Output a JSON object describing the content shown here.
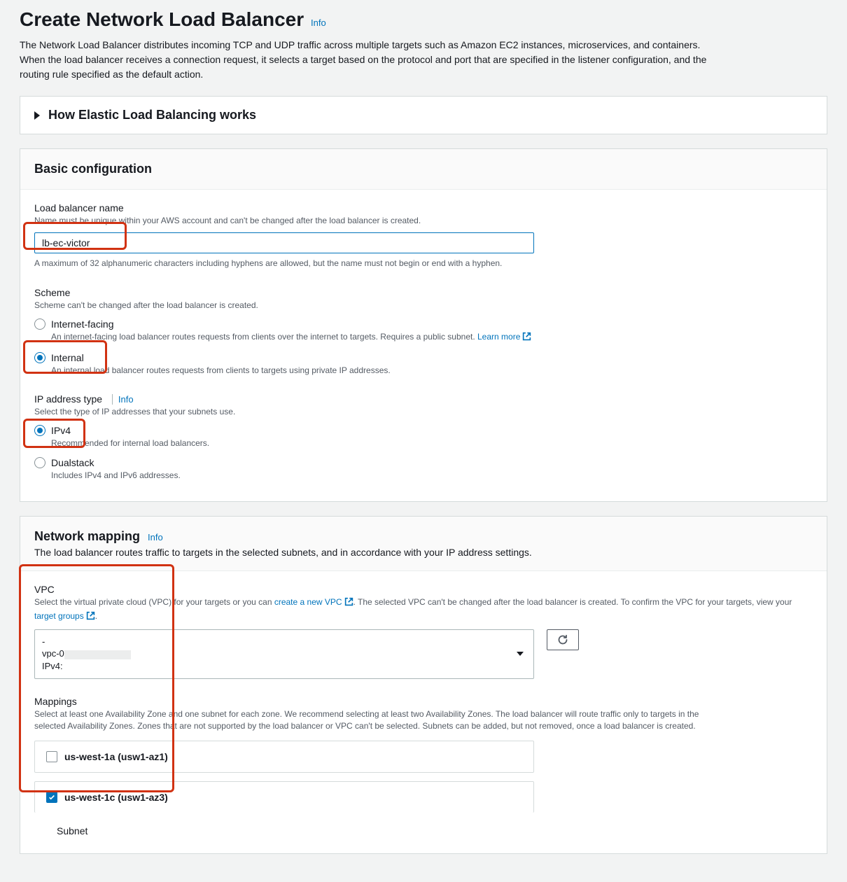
{
  "page": {
    "title": "Create Network Load Balancer",
    "info_label": "Info",
    "description": "The Network Load Balancer distributes incoming TCP and UDP traffic across multiple targets such as Amazon EC2 instances, microservices, and containers. When the load balancer receives a connection request, it selects a target based on the protocol and port that are specified in the listener configuration, and the routing rule specified as the default action."
  },
  "how_works": {
    "title": "How Elastic Load Balancing works"
  },
  "basic": {
    "title": "Basic configuration",
    "name": {
      "label": "Load balancer name",
      "hint_top": "Name must be unique within your AWS account and can't be changed after the load balancer is created.",
      "value": "lb-ec-victor",
      "hint_bottom": "A maximum of 32 alphanumeric characters including hyphens are allowed, but the name must not begin or end with a hyphen."
    },
    "scheme": {
      "label": "Scheme",
      "hint": "Scheme can't be changed after the load balancer is created.",
      "internet_facing": {
        "label": "Internet-facing",
        "desc_pre": "An internet-facing load balancer routes requests from clients over the internet to targets. Requires a public subnet. ",
        "learn_more": "Learn more"
      },
      "internal": {
        "label": "Internal",
        "desc": "An internal load balancer routes requests from clients to targets using private IP addresses."
      }
    },
    "ip_type": {
      "label": "IP address type",
      "info": "Info",
      "hint": "Select the type of IP addresses that your subnets use.",
      "ipv4": {
        "label": "IPv4",
        "desc": "Recommended for internal load balancers."
      },
      "dualstack": {
        "label": "Dualstack",
        "desc": "Includes IPv4 and IPv6 addresses."
      }
    }
  },
  "network": {
    "title": "Network mapping",
    "info": "Info",
    "desc": "The load balancer routes traffic to targets in the selected subnets, and in accordance with your IP address settings.",
    "vpc": {
      "label": "VPC",
      "desc_pre": "Select the virtual private cloud (VPC) for your targets or you can ",
      "create_link": "create a new VPC",
      "desc_mid": ". The selected VPC can't be changed after the load balancer is created. To confirm the VPC for your targets, view your ",
      "tg_link": "target groups",
      "desc_end": ".",
      "select": {
        "dash": "-",
        "vpc_prefix": "vpc-0",
        "ipv4_prefix": "IPv4:"
      }
    },
    "mappings": {
      "label": "Mappings",
      "desc": "Select at least one Availability Zone and one subnet for each zone. We recommend selecting at least two Availability Zones. The load balancer will route traffic only to targets in the selected Availability Zones. Zones that are not supported by the load balancer or VPC can't be selected. Subnets can be added, but not removed, once a load balancer is created.",
      "az1": "us-west-1a (usw1-az1)",
      "az2": "us-west-1c (usw1-az3)",
      "subnet_label": "Subnet"
    }
  }
}
